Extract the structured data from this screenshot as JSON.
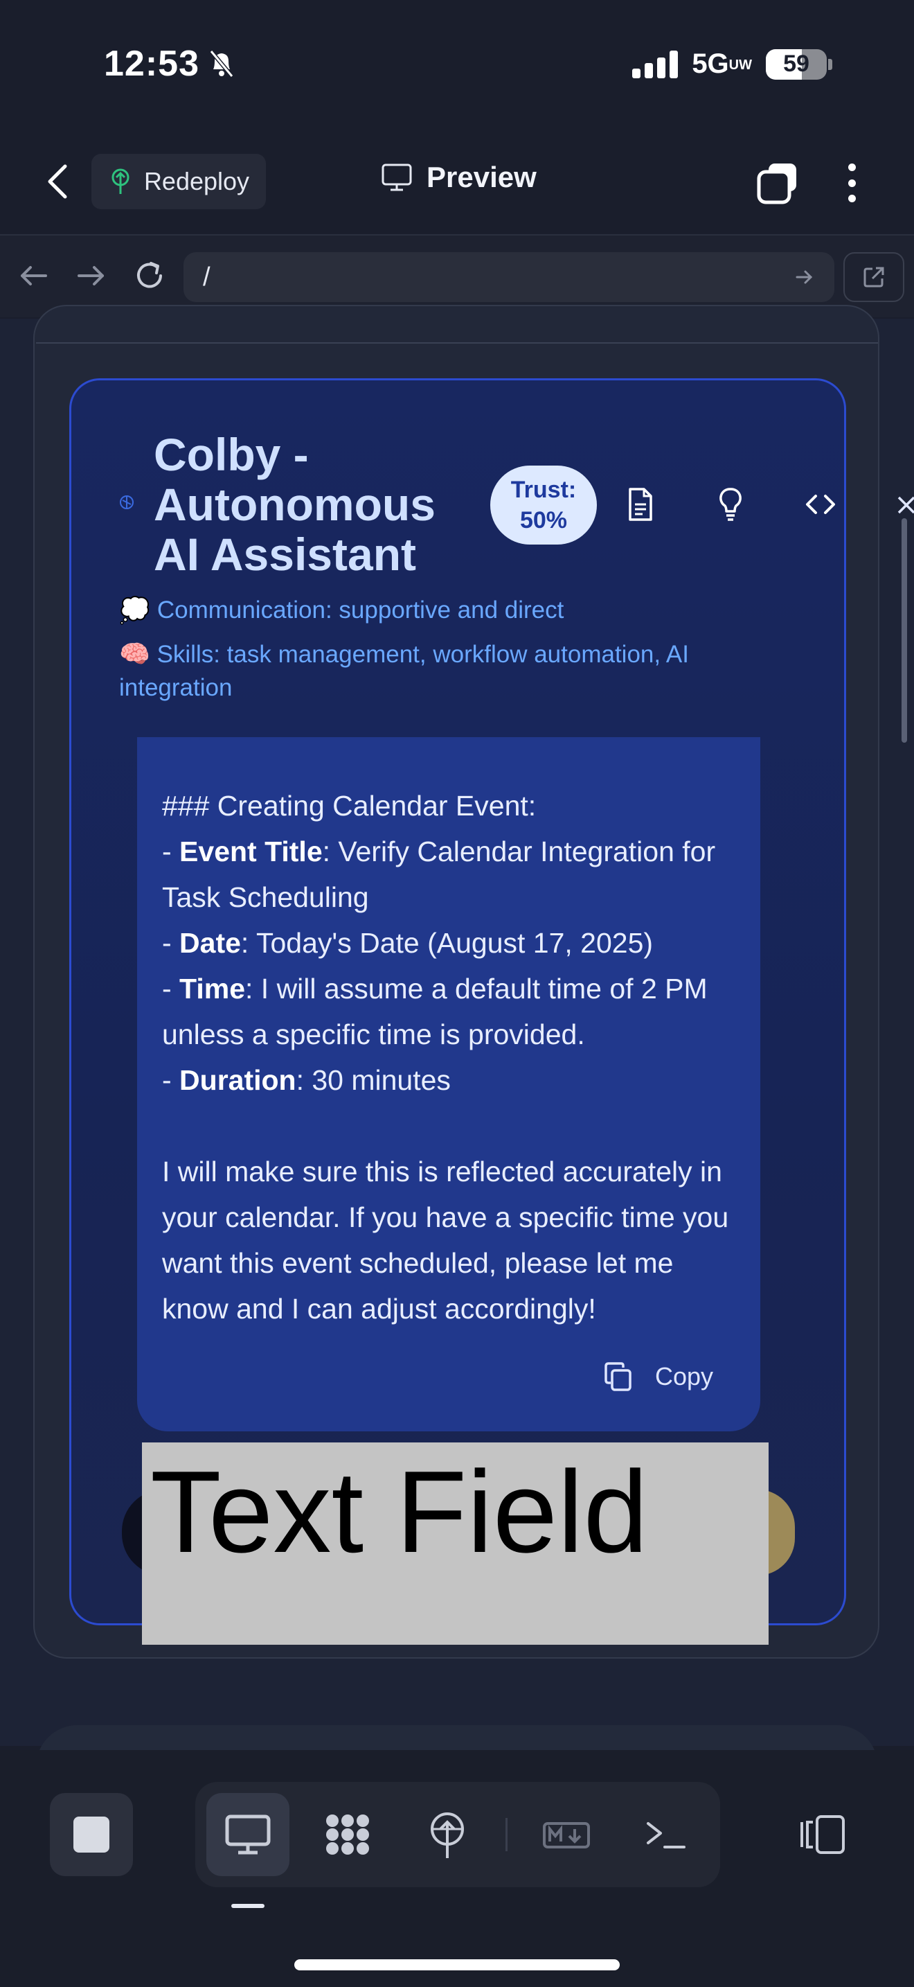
{
  "status_bar": {
    "time": "12:53",
    "network": "5G",
    "network_sub": "UW",
    "battery": "59"
  },
  "header": {
    "redeploy_label": "Redeploy",
    "title": "Preview"
  },
  "url_bar": {
    "url": "/"
  },
  "agent": {
    "name": "Colby - Autonomous AI Assistant",
    "trust_label": "Trust:",
    "trust_value": "50%",
    "communication_emoji": "💭",
    "communication": "Communication: supportive and direct",
    "skills_emoji": "🧠",
    "skills": "Skills: task management, workflow automation, AI integration"
  },
  "message": {
    "heading": "### Creating Calendar Event:",
    "items": [
      {
        "key": "Event Title",
        "value": ": Verify Calendar Integration for Task Scheduling"
      },
      {
        "key": "Date",
        "value": ": Today's Date (August 17, 2025)"
      },
      {
        "key": "Time",
        "value": ": I will assume a default time of 2 PM unless a specific time is provided."
      },
      {
        "key": "Duration",
        "value": ": 30 minutes"
      }
    ],
    "closing": "I will make sure this is reflected accurately in your calendar. If you have a specific time you want this event scheduled, please let me know and I can adjust accordingly!",
    "copy_label": "Copy"
  },
  "text_field": {
    "label": "Text Field"
  },
  "colors": {
    "accent_blue": "#2c4bd0",
    "message_bg": "#21388c",
    "trust_bg": "#dde9ff",
    "redeploy_icon": "#2ec27e"
  },
  "icons": [
    "back-icon",
    "deploy-icon",
    "monitor-icon",
    "tabs-icon",
    "more-icon",
    "nav-back-icon",
    "nav-forward-icon",
    "reload-icon",
    "go-icon",
    "external-link-icon",
    "document-icon",
    "lightbulb-icon",
    "code-icon",
    "close-icon",
    "copy-icon",
    "stop-icon",
    "desktop-icon",
    "apps-icon",
    "deploy-tree-icon",
    "markdown-icon",
    "terminal-icon",
    "layout-toggle-icon"
  ]
}
